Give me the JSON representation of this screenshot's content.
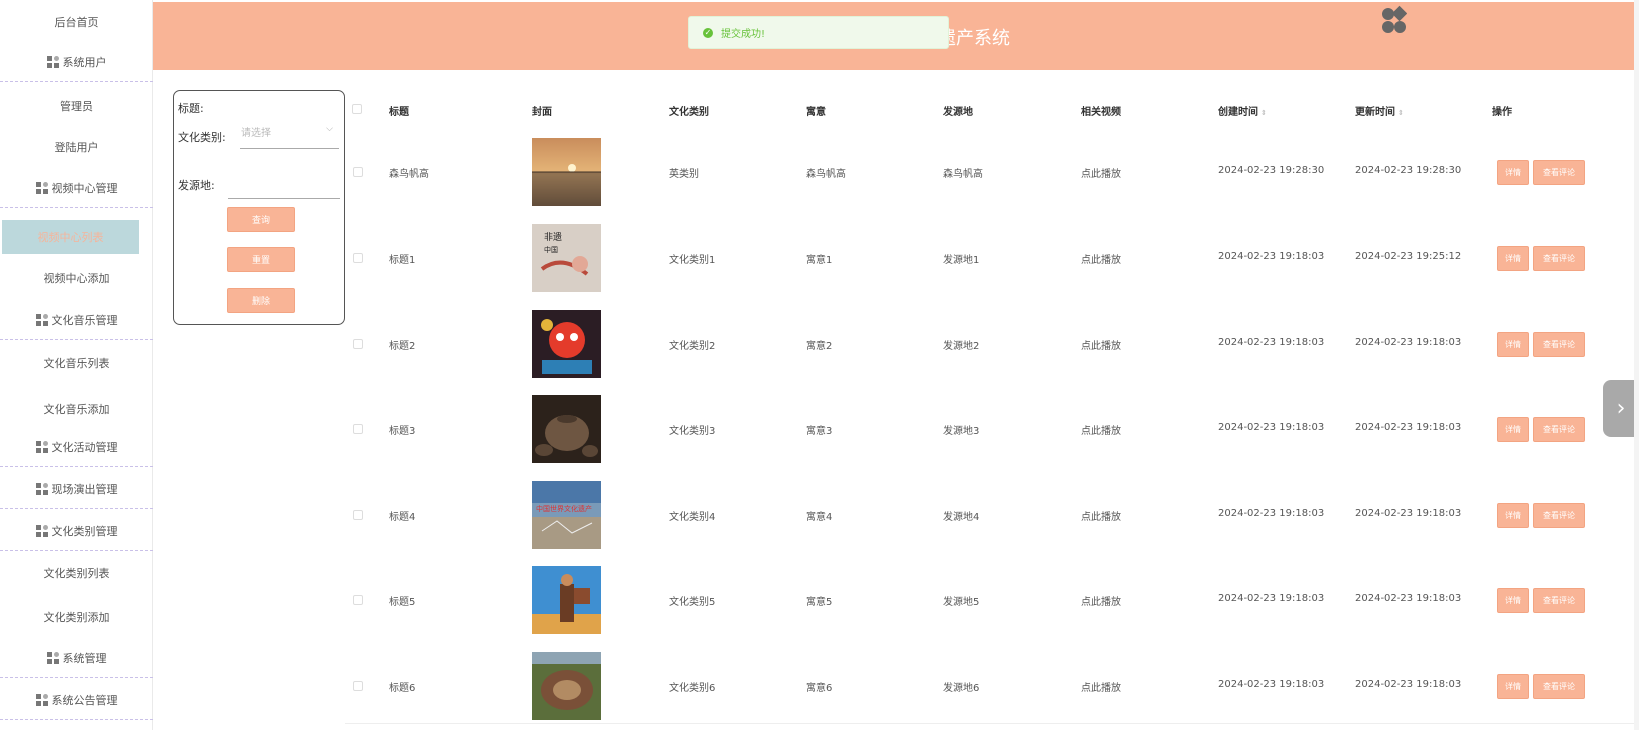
{
  "sidebar": {
    "items": [
      {
        "label": "后台首页",
        "group": false
      },
      {
        "label": "系统用户",
        "group": true
      },
      {
        "label": "管理员",
        "group": false
      },
      {
        "label": "登陆用户",
        "group": false
      },
      {
        "label": "视频中心管理",
        "group": true
      },
      {
        "label": "视频中心列表",
        "group": false,
        "active": true
      },
      {
        "label": "视频中心添加",
        "group": false
      },
      {
        "label": "文化音乐管理",
        "group": true
      },
      {
        "label": "文化音乐列表",
        "group": false
      },
      {
        "label": "文化音乐添加",
        "group": false
      },
      {
        "label": "文化活动管理",
        "group": true
      },
      {
        "label": "现场演出管理",
        "group": true
      },
      {
        "label": "文化类别管理",
        "group": true
      },
      {
        "label": "文化类别列表",
        "group": false
      },
      {
        "label": "文化类别添加",
        "group": false
      },
      {
        "label": "系统管理",
        "group": true
      },
      {
        "label": "系统公告管理",
        "group": true
      }
    ]
  },
  "header": {
    "title": "遗产系统",
    "toast": "提交成功!"
  },
  "search": {
    "title_label": "标题:",
    "category_label": "文化类别:",
    "category_placeholder": "请选择",
    "origin_label": "发源地:",
    "query_button": "查询",
    "reset_button": "重置",
    "delete_button": "删除"
  },
  "table": {
    "columns": [
      "标题",
      "封面",
      "文化类别",
      "寓意",
      "发源地",
      "相关视频",
      "创建时间",
      "更新时间",
      "操作"
    ],
    "detail_button": "详情",
    "comment_button": "查看评论",
    "rows": [
      {
        "title": "森鸟帆高",
        "category": "英类别",
        "meaning": "森鸟帆高",
        "origin": "森鸟帆高",
        "video": "点此播放",
        "created": "2024-02-23 19:28:30",
        "updated": "2024-02-23 19:28:30",
        "cover": "sunset-lake"
      },
      {
        "title": "标题1",
        "category": "文化类别1",
        "meaning": "寓意1",
        "origin": "发源地1",
        "video": "点此播放",
        "created": "2024-02-23 19:18:03",
        "updated": "2024-02-23 19:25:12",
        "cover": "calligraphy-poster"
      },
      {
        "title": "标题2",
        "category": "文化类别2",
        "meaning": "寓意2",
        "origin": "发源地2",
        "video": "点此播放",
        "created": "2024-02-23 19:18:03",
        "updated": "2024-02-23 19:18:03",
        "cover": "opera-mask"
      },
      {
        "title": "标题3",
        "category": "文化类别3",
        "meaning": "寓意3",
        "origin": "发源地3",
        "video": "点此播放",
        "created": "2024-02-23 19:18:03",
        "updated": "2024-02-23 19:18:03",
        "cover": "bronze-vessels"
      },
      {
        "title": "标题4",
        "category": "文化类别4",
        "meaning": "寓意4",
        "origin": "发源地4",
        "video": "点此播放",
        "created": "2024-02-23 19:18:03",
        "updated": "2024-02-23 19:18:03",
        "cover": "heritage-poster"
      },
      {
        "title": "标题5",
        "category": "文化类别5",
        "meaning": "寓意5",
        "origin": "发源地5",
        "video": "点此播放",
        "created": "2024-02-23 19:18:03",
        "updated": "2024-02-23 19:18:03",
        "cover": "performer-sky"
      },
      {
        "title": "标题6",
        "category": "文化类别6",
        "meaning": "寓意6",
        "origin": "发源地6",
        "video": "点此播放",
        "created": "2024-02-23 19:18:03",
        "updated": "2024-02-23 19:18:03",
        "cover": "tulou-aerial"
      }
    ]
  },
  "colors": {
    "accent": "#f9b496",
    "active_bg": "#bcd8dc",
    "success": "#67c23a"
  }
}
